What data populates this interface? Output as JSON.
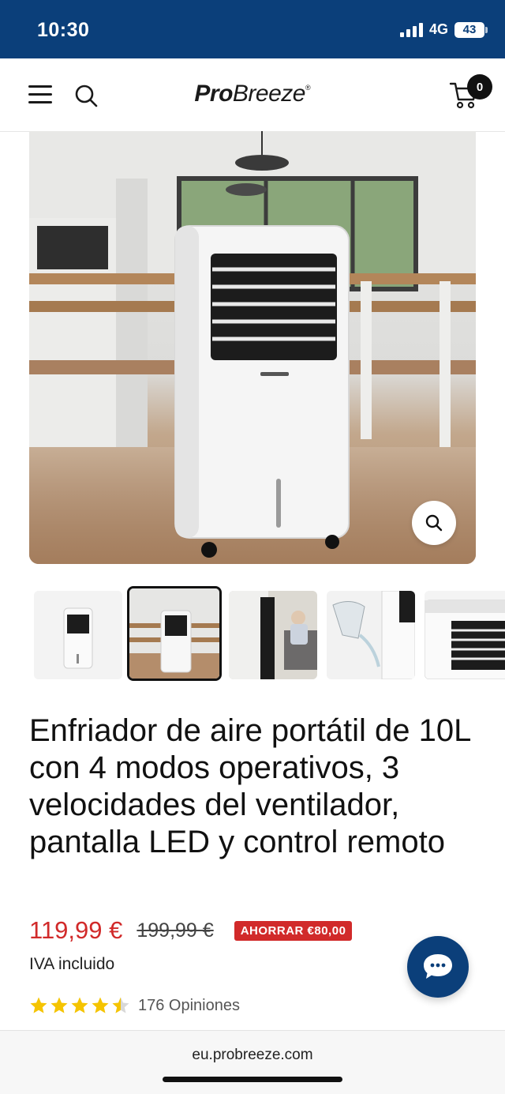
{
  "status_bar": {
    "time": "10:30",
    "network": "4G",
    "battery": "43",
    "battery_level": 0.43
  },
  "header": {
    "logo_bold": "Pro",
    "logo_light": "Breeze",
    "logo_mark": "®",
    "cart_count": "0",
    "icons": {
      "menu": "hamburger-menu-icon",
      "search": "search-icon",
      "cart": "shopping-cart-icon"
    }
  },
  "gallery": {
    "active_index": 1,
    "thumbnails": [
      "air-cooler-front-white-background",
      "air-cooler-living-room",
      "air-cooler-with-woman-on-sofa",
      "water-jug-filling-tank",
      "air-cooler-top-control-panel"
    ],
    "zoom_icon": "zoom-icon"
  },
  "product": {
    "title": "Enfriador de aire portátil de 10L con 4 modos operativos, 3 velocidades del ventilador, pantalla LED y control remoto",
    "price": "119,99 €",
    "compare_price": "199,99 €",
    "save_badge": "AHORRAR €80,00",
    "tax_note": "IVA incluido",
    "rating": 4.5,
    "reviews": "176 Opiniones"
  },
  "chat": {
    "icon": "chat-bubble-icon"
  },
  "browser": {
    "url": "eu.probreeze.com"
  },
  "colors": {
    "brand_blue": "#0b3f7a",
    "sale_red": "#d12a2a",
    "star_yellow": "#f5c400"
  }
}
